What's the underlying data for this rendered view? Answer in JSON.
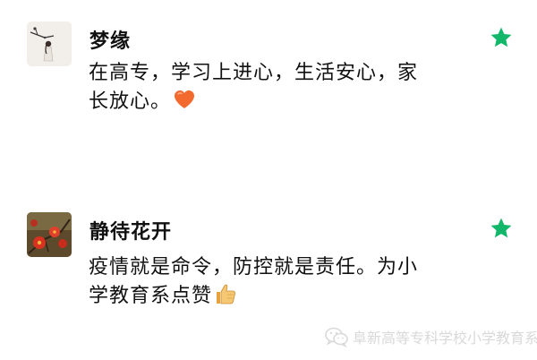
{
  "colors": {
    "star": "#12B76A",
    "text": "#111111",
    "watermark": "#D9D9D9",
    "background": "#FFFFFF"
  },
  "comments": [
    {
      "username": "梦缘",
      "text_lines": [
        "在高专，学习上进心，生活安心，家",
        "长放心。"
      ],
      "emoji": "orange-heart-icon",
      "starred": true
    },
    {
      "username": "静待花开",
      "text_lines": [
        "疫情就是命令，防控就是责任。为小",
        "学教育系点赞"
      ],
      "emoji": "thumbs-up-icon",
      "starred": true
    }
  ],
  "watermark": {
    "icon": "wechat-icon",
    "text": "阜新高等专科学校小学教育系"
  }
}
